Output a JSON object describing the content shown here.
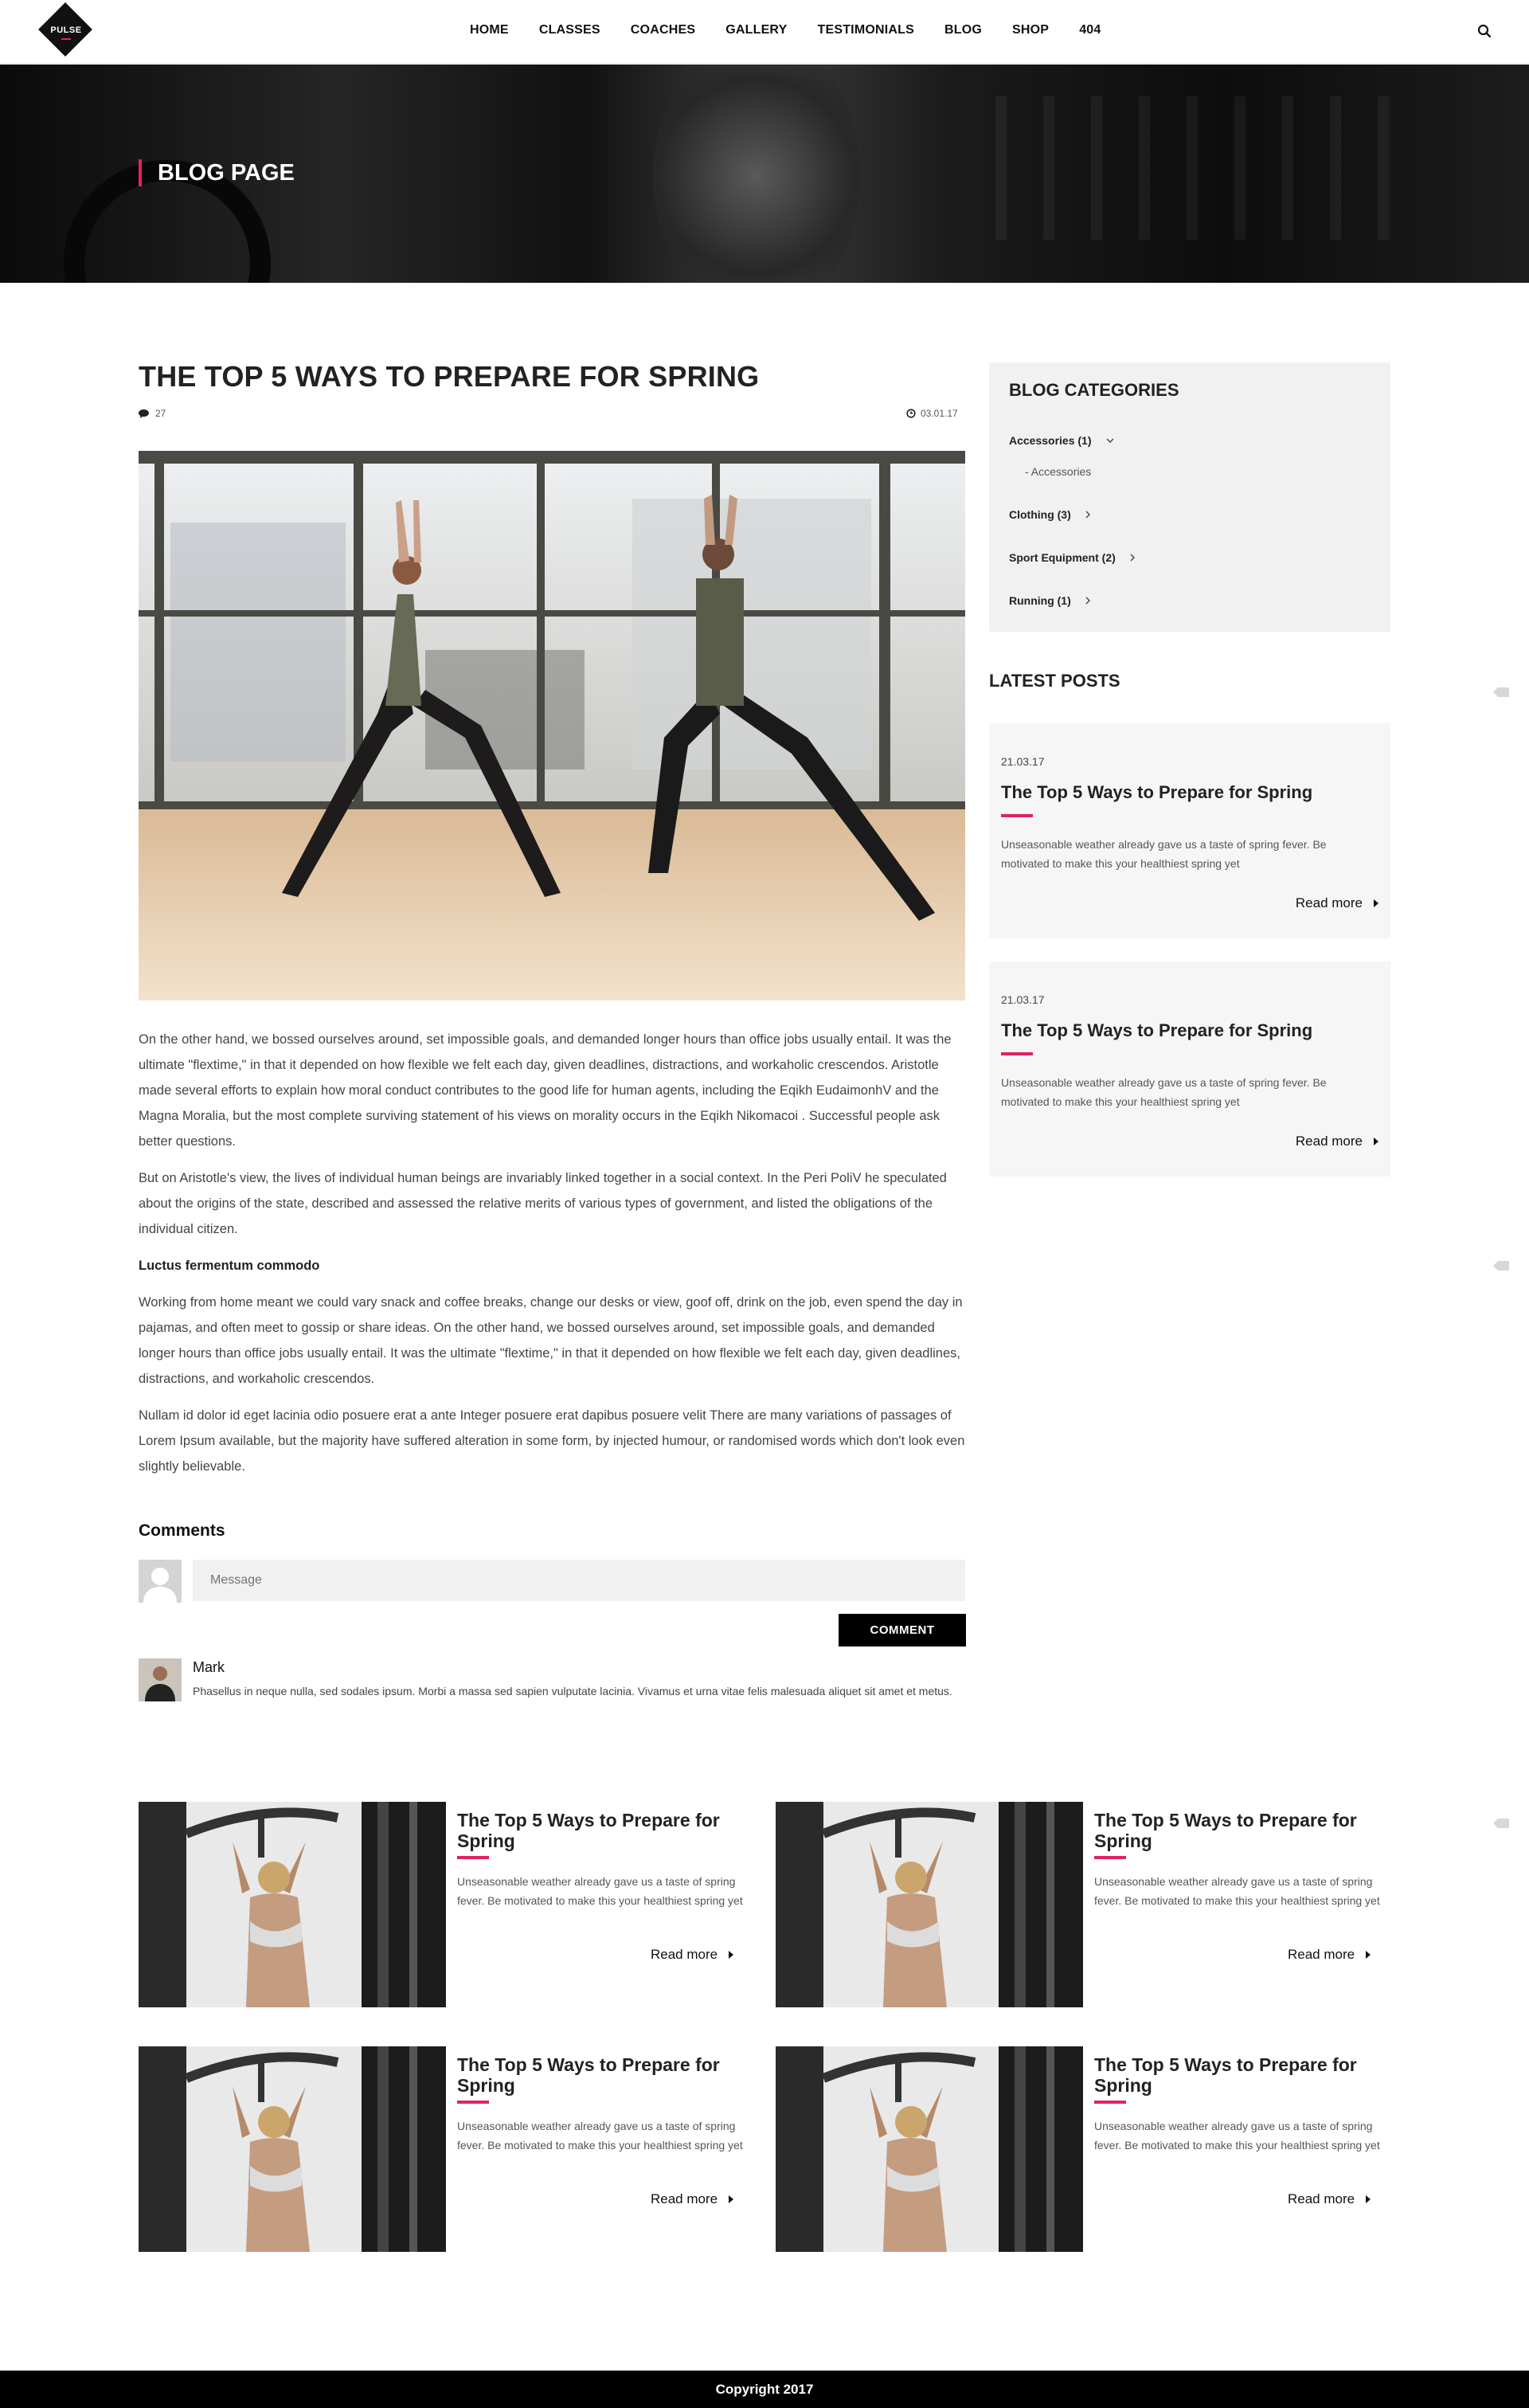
{
  "brand": {
    "logo_text": "PULSE",
    "accent": "#e0245e"
  },
  "nav": {
    "items": [
      "HOME",
      "CLASSES",
      "COACHES",
      "GALLERY",
      "TESTIMONIALS",
      "BLOG",
      "SHOP",
      "404"
    ],
    "search_icon": "search-icon"
  },
  "hero": {
    "title": "BLOG PAGE"
  },
  "post": {
    "title": "THE TOP 5 WAYS TO PREPARE FOR SPRING",
    "comment_count": "27",
    "date": "03.01.17",
    "paragraphs": [
      "On the other hand, we bossed ourselves around, set impossible goals, and demanded longer hours than office jobs usually entail. It was the ultimate \"flextime,\" in that it depended on how flexible we felt each day, given deadlines, distractions, and workaholic crescendos. Aristotle made several efforts to explain how moral conduct contributes to the good life for human agents, including the Eqikh EudaimonhV and the Magna Moralia, but the most complete surviving statement of his views on morality occurs in the Eqikh Nikomacoi . Successful people ask better questions.",
      "But on Aristotle's view, the lives of individual human beings are invariably linked together in a social context. In the Peri PoliV he speculated about the origins of the state, described and assessed the relative merits of various types of government, and listed the obligations of the individual citizen.",
      "Luctus fermentum commodo",
      "Working from home meant we could vary snack and coffee breaks, change our desks or view, goof off, drink on the job, even spend the day in pajamas, and often meet to gossip or share ideas. On the other hand, we bossed ourselves around, set impossible goals, and demanded longer hours than office jobs usually entail. It was the ultimate \"flextime,\" in that it depended on how flexible we felt each day, given deadlines, distractions, and workaholic crescendos.",
      "Nullam id dolor id eget lacinia odio posuere erat a ante Integer posuere erat dapibus posuere velit There are many variations of passages of Lorem Ipsum available, but the majority have suffered alteration in some form, by injected humour, or randomised words which don't look even slightly believable."
    ]
  },
  "comments": {
    "heading": "Comments",
    "placeholder": "Message",
    "button": "COMMENT",
    "items": [
      {
        "name": "Mark",
        "text": "Phasellus in neque nulla, sed sodales ipsum. Morbi a massa sed sapien vulputate lacinia. Vivamus et urna vitae felis malesuada aliquet sit amet et metus."
      }
    ]
  },
  "sidebar": {
    "categories_title": "BLOG CATEGORIES",
    "categories": [
      {
        "label": "Accessories (1)",
        "expanded": true
      },
      {
        "label": "Clothing (3)"
      },
      {
        "label": "Sport Equipment (2)"
      },
      {
        "label": "Running (1)"
      }
    ],
    "subcategory": "- Accessories",
    "latest_title": "LATEST POSTS",
    "latest": [
      {
        "date": "21.03.17",
        "title": "The Top 5 Ways to Prepare for Spring",
        "desc": "Unseasonable weather already gave us a taste of spring fever. Be motivated to make this your healthiest spring yet",
        "more": "Read more"
      },
      {
        "date": "21.03.17",
        "title": "The Top 5 Ways to Prepare for Spring",
        "desc": "Unseasonable weather already gave us a taste of spring fever. Be motivated to make this your healthiest spring yet",
        "more": "Read more"
      }
    ]
  },
  "related": [
    {
      "title": "The Top 5 Ways to Prepare for Spring",
      "desc": "Unseasonable weather already gave us a taste of spring fever. Be motivated to make this your healthiest spring yet",
      "more": "Read more"
    },
    {
      "title": "The Top 5 Ways to Prepare for Spring",
      "desc": "Unseasonable weather already gave us a taste of spring fever. Be motivated to make this your healthiest spring yet",
      "more": "Read more"
    },
    {
      "title": "The Top 5 Ways to Prepare for Spring",
      "desc": "Unseasonable weather already gave us a taste of spring fever. Be motivated to make this your healthiest spring yet",
      "more": "Read more"
    },
    {
      "title": "The Top 5 Ways to Prepare for Spring",
      "desc": "Unseasonable weather already gave us a taste of spring fever. Be motivated to make this your healthiest spring yet",
      "more": "Read more"
    }
  ],
  "footer": {
    "copyright": "Copyright 2017"
  }
}
